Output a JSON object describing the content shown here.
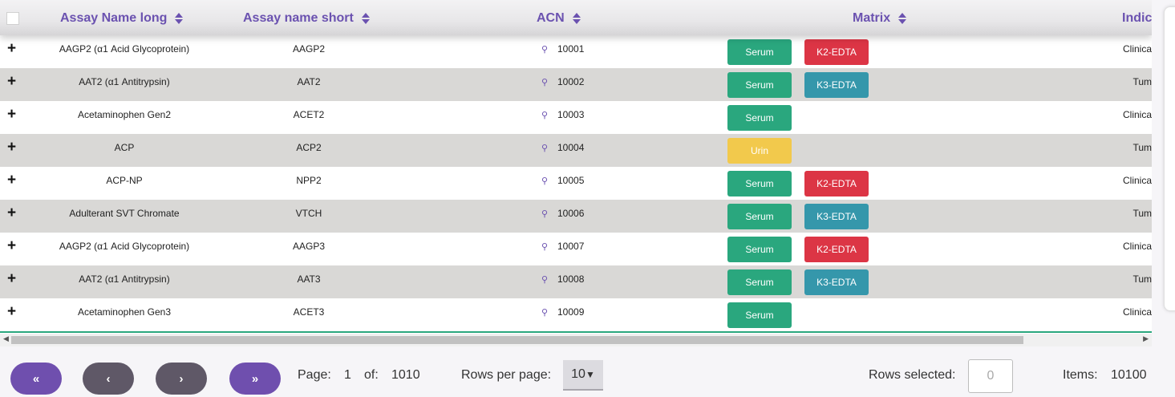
{
  "colors": {
    "header_text": "#6b52b0",
    "serum": "#2aa77e",
    "urin": "#f2c94c",
    "k2_edta": "#dc3545",
    "k3_edta": "#3597ab",
    "pager_purple": "#6f4fae",
    "pager_gray": "#5f5867"
  },
  "columns": [
    {
      "label": "Assay Name long"
    },
    {
      "label": "Assay name short"
    },
    {
      "label": "ACN"
    },
    {
      "label": "Matrix"
    },
    {
      "label": "Indic"
    }
  ],
  "rows": [
    {
      "expand": "+",
      "long": "AAGP2 (α1 Acid Glycoprotein)",
      "short": "AAGP2",
      "acn": "10001",
      "matrix": [
        "Serum",
        "K2-EDTA"
      ],
      "indication": "Clinica"
    },
    {
      "expand": "+",
      "long": "AAT2 (α1 Antitrypsin)",
      "short": "AAT2",
      "acn": "10002",
      "matrix": [
        "Serum",
        "K3-EDTA"
      ],
      "indication": "Tum"
    },
    {
      "expand": "+",
      "long": "Acetaminophen Gen2",
      "short": "ACET2",
      "acn": "10003",
      "matrix": [
        "Serum"
      ],
      "indication": "Clinica"
    },
    {
      "expand": "+",
      "long": "ACP",
      "short": "ACP2",
      "acn": "10004",
      "matrix": [
        "Urin"
      ],
      "indication": "Tum"
    },
    {
      "expand": "+",
      "long": "ACP-NP",
      "short": "NPP2",
      "acn": "10005",
      "matrix": [
        "Serum",
        "K2-EDTA"
      ],
      "indication": "Clinica"
    },
    {
      "expand": "+",
      "long": "Adulterant SVT Chromate",
      "short": "VTCH",
      "acn": "10006",
      "matrix": [
        "Serum",
        "K3-EDTA"
      ],
      "indication": "Tum"
    },
    {
      "expand": "+",
      "long": "AAGP2 (α1 Acid Glycoprotein)",
      "short": "AAGP3",
      "acn": "10007",
      "matrix": [
        "Serum",
        "K2-EDTA"
      ],
      "indication": "Clinica"
    },
    {
      "expand": "+",
      "long": "AAT2 (α1 Antitrypsin)",
      "short": "AAT3",
      "acn": "10008",
      "matrix": [
        "Serum",
        "K3-EDTA"
      ],
      "indication": "Tum"
    },
    {
      "expand": "+",
      "long": "Acetaminophen Gen3",
      "short": "ACET3",
      "acn": "10009",
      "matrix": [
        "Serum"
      ],
      "indication": "Clinica"
    }
  ],
  "pagination": {
    "first_label": "«",
    "prev_label": "‹",
    "next_label": "›",
    "last_label": "»",
    "page_label": "Page:",
    "page_value": "1",
    "of_label": "of:",
    "total_pages": "1010",
    "rows_per_page_label": "Rows per page:",
    "rows_per_page_value": "10",
    "rows_selected_label": "Rows selected:",
    "rows_selected_value": "0",
    "items_label": "Items:",
    "items_value": "10100"
  },
  "icons": {
    "expand": "plus-icon",
    "link": "link-icon",
    "sort": "sort-icon",
    "dropdown": "caret-down-icon"
  }
}
